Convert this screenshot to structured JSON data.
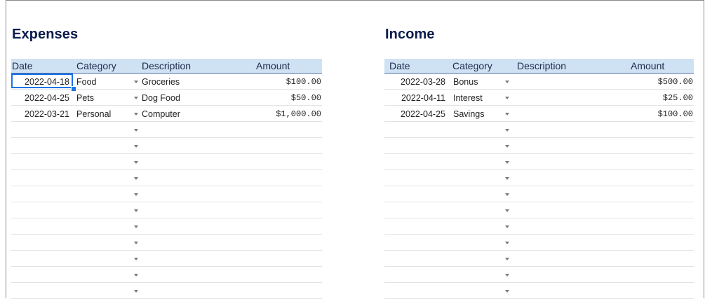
{
  "expenses": {
    "title": "Expenses",
    "headers": {
      "date": "Date",
      "category": "Category",
      "description": "Description",
      "amount": "Amount"
    },
    "rows": [
      {
        "date": "2022-04-18",
        "category": "Food",
        "description": "Groceries",
        "amount": "$100.00"
      },
      {
        "date": "2022-04-25",
        "category": "Pets",
        "description": "Dog Food",
        "amount": "$50.00"
      },
      {
        "date": "2022-03-21",
        "category": "Personal",
        "description": "Computer",
        "amount": "$1,000.00"
      },
      {
        "date": "",
        "category": "",
        "description": "",
        "amount": ""
      },
      {
        "date": "",
        "category": "",
        "description": "",
        "amount": ""
      },
      {
        "date": "",
        "category": "",
        "description": "",
        "amount": ""
      },
      {
        "date": "",
        "category": "",
        "description": "",
        "amount": ""
      },
      {
        "date": "",
        "category": "",
        "description": "",
        "amount": ""
      },
      {
        "date": "",
        "category": "",
        "description": "",
        "amount": ""
      },
      {
        "date": "",
        "category": "",
        "description": "",
        "amount": ""
      },
      {
        "date": "",
        "category": "",
        "description": "",
        "amount": ""
      },
      {
        "date": "",
        "category": "",
        "description": "",
        "amount": ""
      },
      {
        "date": "",
        "category": "",
        "description": "",
        "amount": ""
      },
      {
        "date": "",
        "category": "",
        "description": "",
        "amount": ""
      }
    ]
  },
  "income": {
    "title": "Income",
    "headers": {
      "date": "Date",
      "category": "Category",
      "description": "Description",
      "amount": "Amount"
    },
    "rows": [
      {
        "date": "2022-03-28",
        "category": "Bonus",
        "description": "",
        "amount": "$500.00"
      },
      {
        "date": "2022-04-11",
        "category": "Interest",
        "description": "",
        "amount": "$25.00"
      },
      {
        "date": "2022-04-25",
        "category": "Savings",
        "description": "",
        "amount": "$100.00"
      },
      {
        "date": "",
        "category": "",
        "description": "",
        "amount": ""
      },
      {
        "date": "",
        "category": "",
        "description": "",
        "amount": ""
      },
      {
        "date": "",
        "category": "",
        "description": "",
        "amount": ""
      },
      {
        "date": "",
        "category": "",
        "description": "",
        "amount": ""
      },
      {
        "date": "",
        "category": "",
        "description": "",
        "amount": ""
      },
      {
        "date": "",
        "category": "",
        "description": "",
        "amount": ""
      },
      {
        "date": "",
        "category": "",
        "description": "",
        "amount": ""
      },
      {
        "date": "",
        "category": "",
        "description": "",
        "amount": ""
      },
      {
        "date": "",
        "category": "",
        "description": "",
        "amount": ""
      },
      {
        "date": "",
        "category": "",
        "description": "",
        "amount": ""
      },
      {
        "date": "",
        "category": "",
        "description": "",
        "amount": ""
      }
    ]
  },
  "icons": {
    "dropdown": "chevron-down-icon"
  },
  "colors": {
    "header_bg": "#cfe2f3",
    "title": "#0b1c4d",
    "selection": "#1a73e8"
  }
}
